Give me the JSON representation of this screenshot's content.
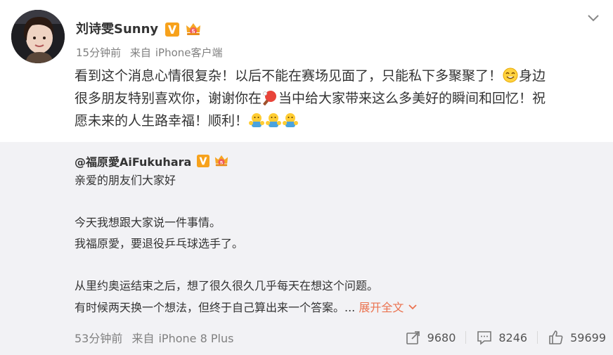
{
  "post": {
    "author": "刘诗雯Sunny",
    "time": "15分钟前",
    "source_prefix": "来自",
    "source": "iPhone客户端",
    "text_lines": [
      [
        "看到这个消息心情很复杂！以后不能在赛场见面了，只能私下多聚聚了！",
        "身边"
      ],
      [
        "很多朋友特别喜欢你，谢谢你在",
        "当中给大家带来这么多美好的瞬间和回忆！祝"
      ],
      [
        "愿未来的人生路幸福！顺利！"
      ]
    ]
  },
  "repost": {
    "author": "@福原愛AiFukuhara",
    "lines": [
      "亲爱的朋友们大家好",
      "",
      "今天我想跟大家说一件事情。",
      "我福原愛，要退役乒乓球选手了。",
      "",
      "从里约奥运结束之后，想了很久很久几乎每天在想这个问题。",
      "有时候两天换一个想法，但终于自己算出来一个答案。..."
    ],
    "expand_label": "展开全文",
    "time": "53分钟前",
    "source_prefix": "来自",
    "source": "iPhone 8 Plus",
    "shares": "9680",
    "comments": "8246",
    "likes": "59699"
  },
  "colors": {
    "accent": "#eb7350",
    "meta": "#808080",
    "repost_bg": "#f2f2f5",
    "vip_badge": "#f7a21c"
  },
  "icons": [
    "verified-v-icon",
    "crown-icon",
    "chevron-down-icon",
    "smile-emoji-icon",
    "pingpong-emoji-icon",
    "hug-emoji-icon",
    "share-icon",
    "comment-icon",
    "like-icon"
  ]
}
